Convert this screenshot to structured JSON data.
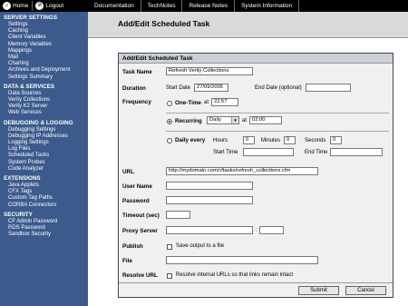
{
  "topbar": {
    "home_label": "Home",
    "logout_label": "Logout",
    "links": [
      "Documentation",
      "TechNotes",
      "Release Notes",
      "System Information"
    ]
  },
  "sidebar": {
    "sections": [
      {
        "title": "SERVER SETTINGS",
        "items": [
          "Settings",
          "Caching",
          "Client Variables",
          "Memory Variables",
          "Mappings",
          "Mail",
          "Charting",
          "Archives and Deployment",
          "Settings Summary"
        ]
      },
      {
        "title": "DATA & SERVICES",
        "items": [
          "Data Sources",
          "Verity Collections",
          "Verity K2 Server",
          "Web Services"
        ]
      },
      {
        "title": "DEBUGGING & LOGGING",
        "items": [
          "Debugging Settings",
          "Debugging IP Addresses",
          "Logging Settings",
          "Log Files",
          "Scheduled Tasks",
          "System Probes",
          "Code Analyzer"
        ]
      },
      {
        "title": "EXTENSIONS",
        "items": [
          "Java Applets",
          "CFX Tags",
          "Custom Tag Paths",
          "CORBA Connectors"
        ]
      },
      {
        "title": "SECURITY",
        "items": [
          "CF Admin Password",
          "RDS Password",
          "Sandbox Security"
        ]
      }
    ]
  },
  "page": {
    "title": "Add/Edit Scheduled Task",
    "panel_title": "Add/Edit Scheduled Task"
  },
  "form": {
    "task_name_label": "Task Name",
    "task_name_value": "Refresh Verity Collections",
    "duration_label": "Duration",
    "start_date_label": "Start Date",
    "start_date_value": "27/09/2005",
    "end_date_label": "End Date (optional)",
    "end_date_value": "",
    "frequency_label": "Frequency",
    "one_time_label": "One-Time",
    "one_time_at_label": "at",
    "one_time_value": "22:57",
    "recurring_label": "Recurring",
    "recurring_select": "Daily",
    "recurring_at_label": "at",
    "recurring_time": "02:00",
    "daily_every_label": "Daily every",
    "hours_label": "Hours",
    "hours_value": "0",
    "minutes_label": "Minutes",
    "minutes_value": "0",
    "seconds_label": "Seconds",
    "seconds_value": "0",
    "start_time_label": "Start Time",
    "end_time_label": "End Time",
    "url_label": "URL",
    "url_value": "http://mydomain.com/cftasks/refresh_collections.cfm",
    "username_label": "User Name",
    "password_label": "Password",
    "timeout_label": "Timeout (sec)",
    "proxy_label": "Proxy Server",
    "proxy_colon": ":",
    "publish_label": "Publish",
    "publish_checkbox_label": "Save output to a file",
    "file_label": "File",
    "resolve_label": "Resolve URL",
    "resolve_checkbox_label": "Resolve internal URLs so that links remain intact",
    "submit_label": "Submit",
    "cancel_label": "Cancel"
  }
}
